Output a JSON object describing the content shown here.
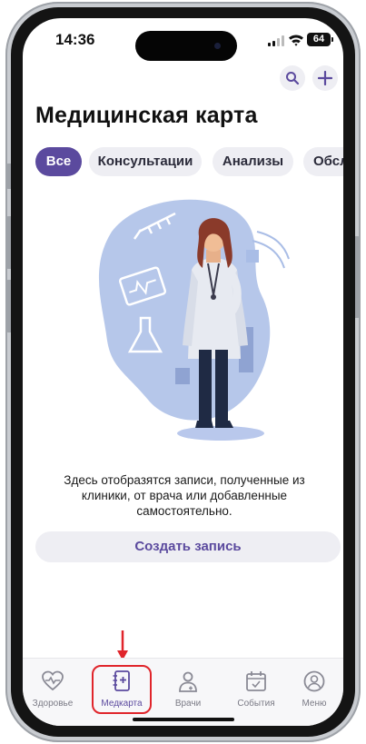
{
  "status": {
    "time": "14:36",
    "battery": "64"
  },
  "header": {
    "title": "Медицинская карта"
  },
  "tabs": [
    {
      "label": "Все",
      "active": true
    },
    {
      "label": "Консультации",
      "active": false
    },
    {
      "label": "Анализы",
      "active": false
    },
    {
      "label": "Обсле",
      "active": false
    }
  ],
  "empty_state": {
    "text": "Здесь отобразятся записи, полученные из клиники, от врача или добавленные самостоятельно."
  },
  "create_button": {
    "label": "Создать запись"
  },
  "nav": [
    {
      "label": "Здоровье",
      "icon": "heart-pulse-icon"
    },
    {
      "label": "Медкарта",
      "icon": "medical-record-icon",
      "active": true
    },
    {
      "label": "Врачи",
      "icon": "doctor-icon"
    },
    {
      "label": "События",
      "icon": "calendar-icon"
    },
    {
      "label": "Меню",
      "icon": "profile-icon"
    }
  ],
  "colors": {
    "accent": "#5b4a9e",
    "chip_bg": "#eeeef3",
    "highlight": "#e0252b"
  }
}
